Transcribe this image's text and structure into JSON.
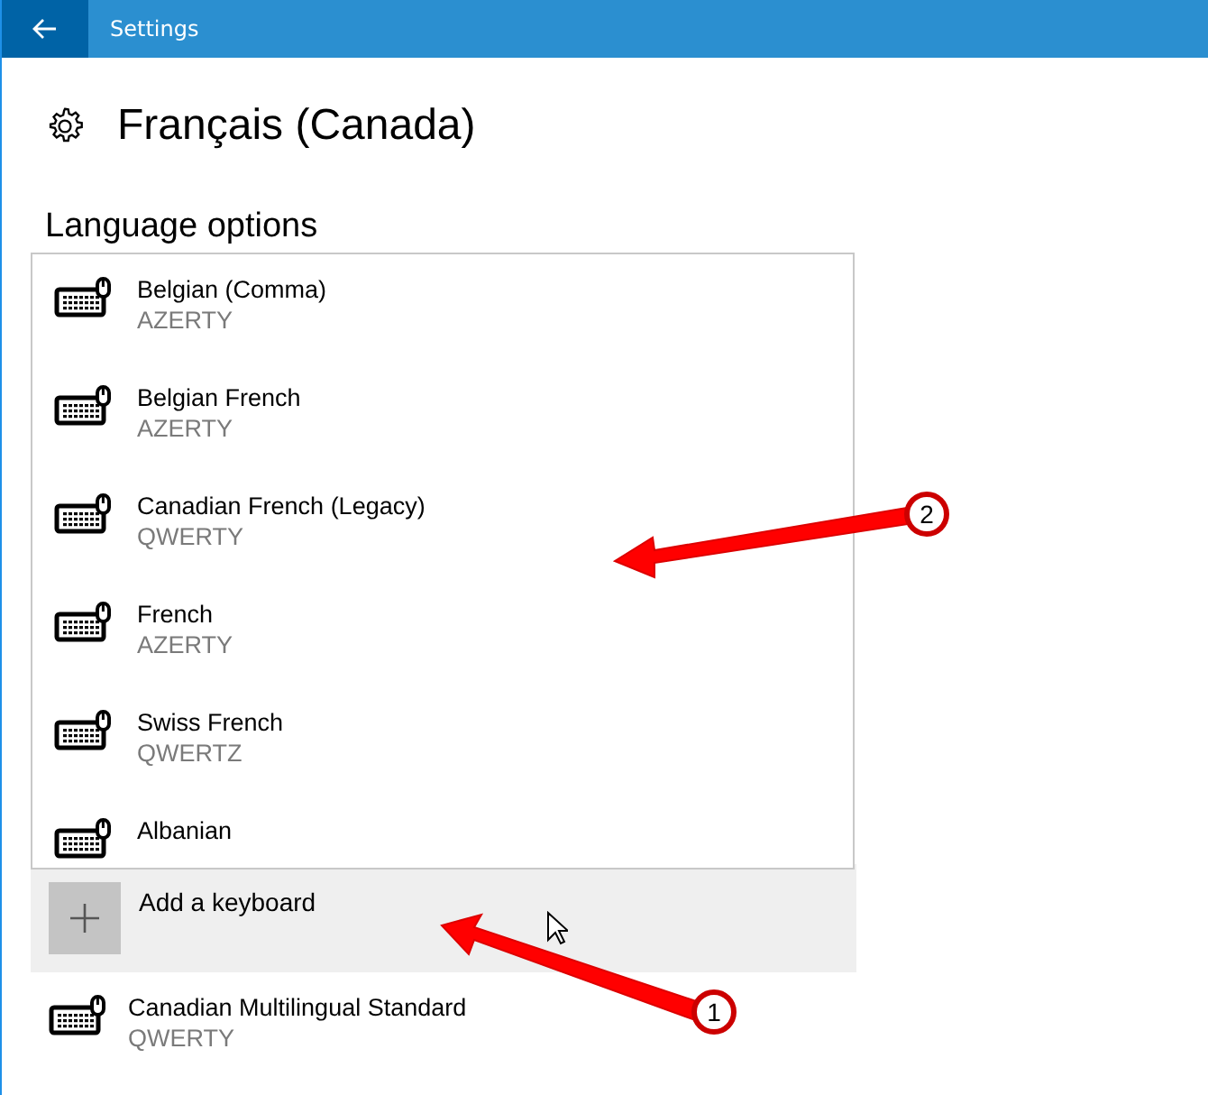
{
  "window": {
    "title": "Settings"
  },
  "page": {
    "title": "Français (Canada)",
    "section": "Language options"
  },
  "keyboard_menu": {
    "items": [
      {
        "name": "Belgian (Comma)",
        "layout": "AZERTY"
      },
      {
        "name": "Belgian French",
        "layout": "AZERTY"
      },
      {
        "name": "Canadian French (Legacy)",
        "layout": "QWERTY"
      },
      {
        "name": "French",
        "layout": "AZERTY"
      },
      {
        "name": "Swiss French",
        "layout": "QWERTZ"
      },
      {
        "name": "Albanian"
      }
    ]
  },
  "add_keyboard": {
    "label": "Add a keyboard"
  },
  "installed_keyboards": [
    {
      "name": "Canadian Multilingual Standard",
      "layout": "QWERTY"
    }
  ],
  "callouts": [
    {
      "number": "1"
    },
    {
      "number": "2"
    }
  ]
}
